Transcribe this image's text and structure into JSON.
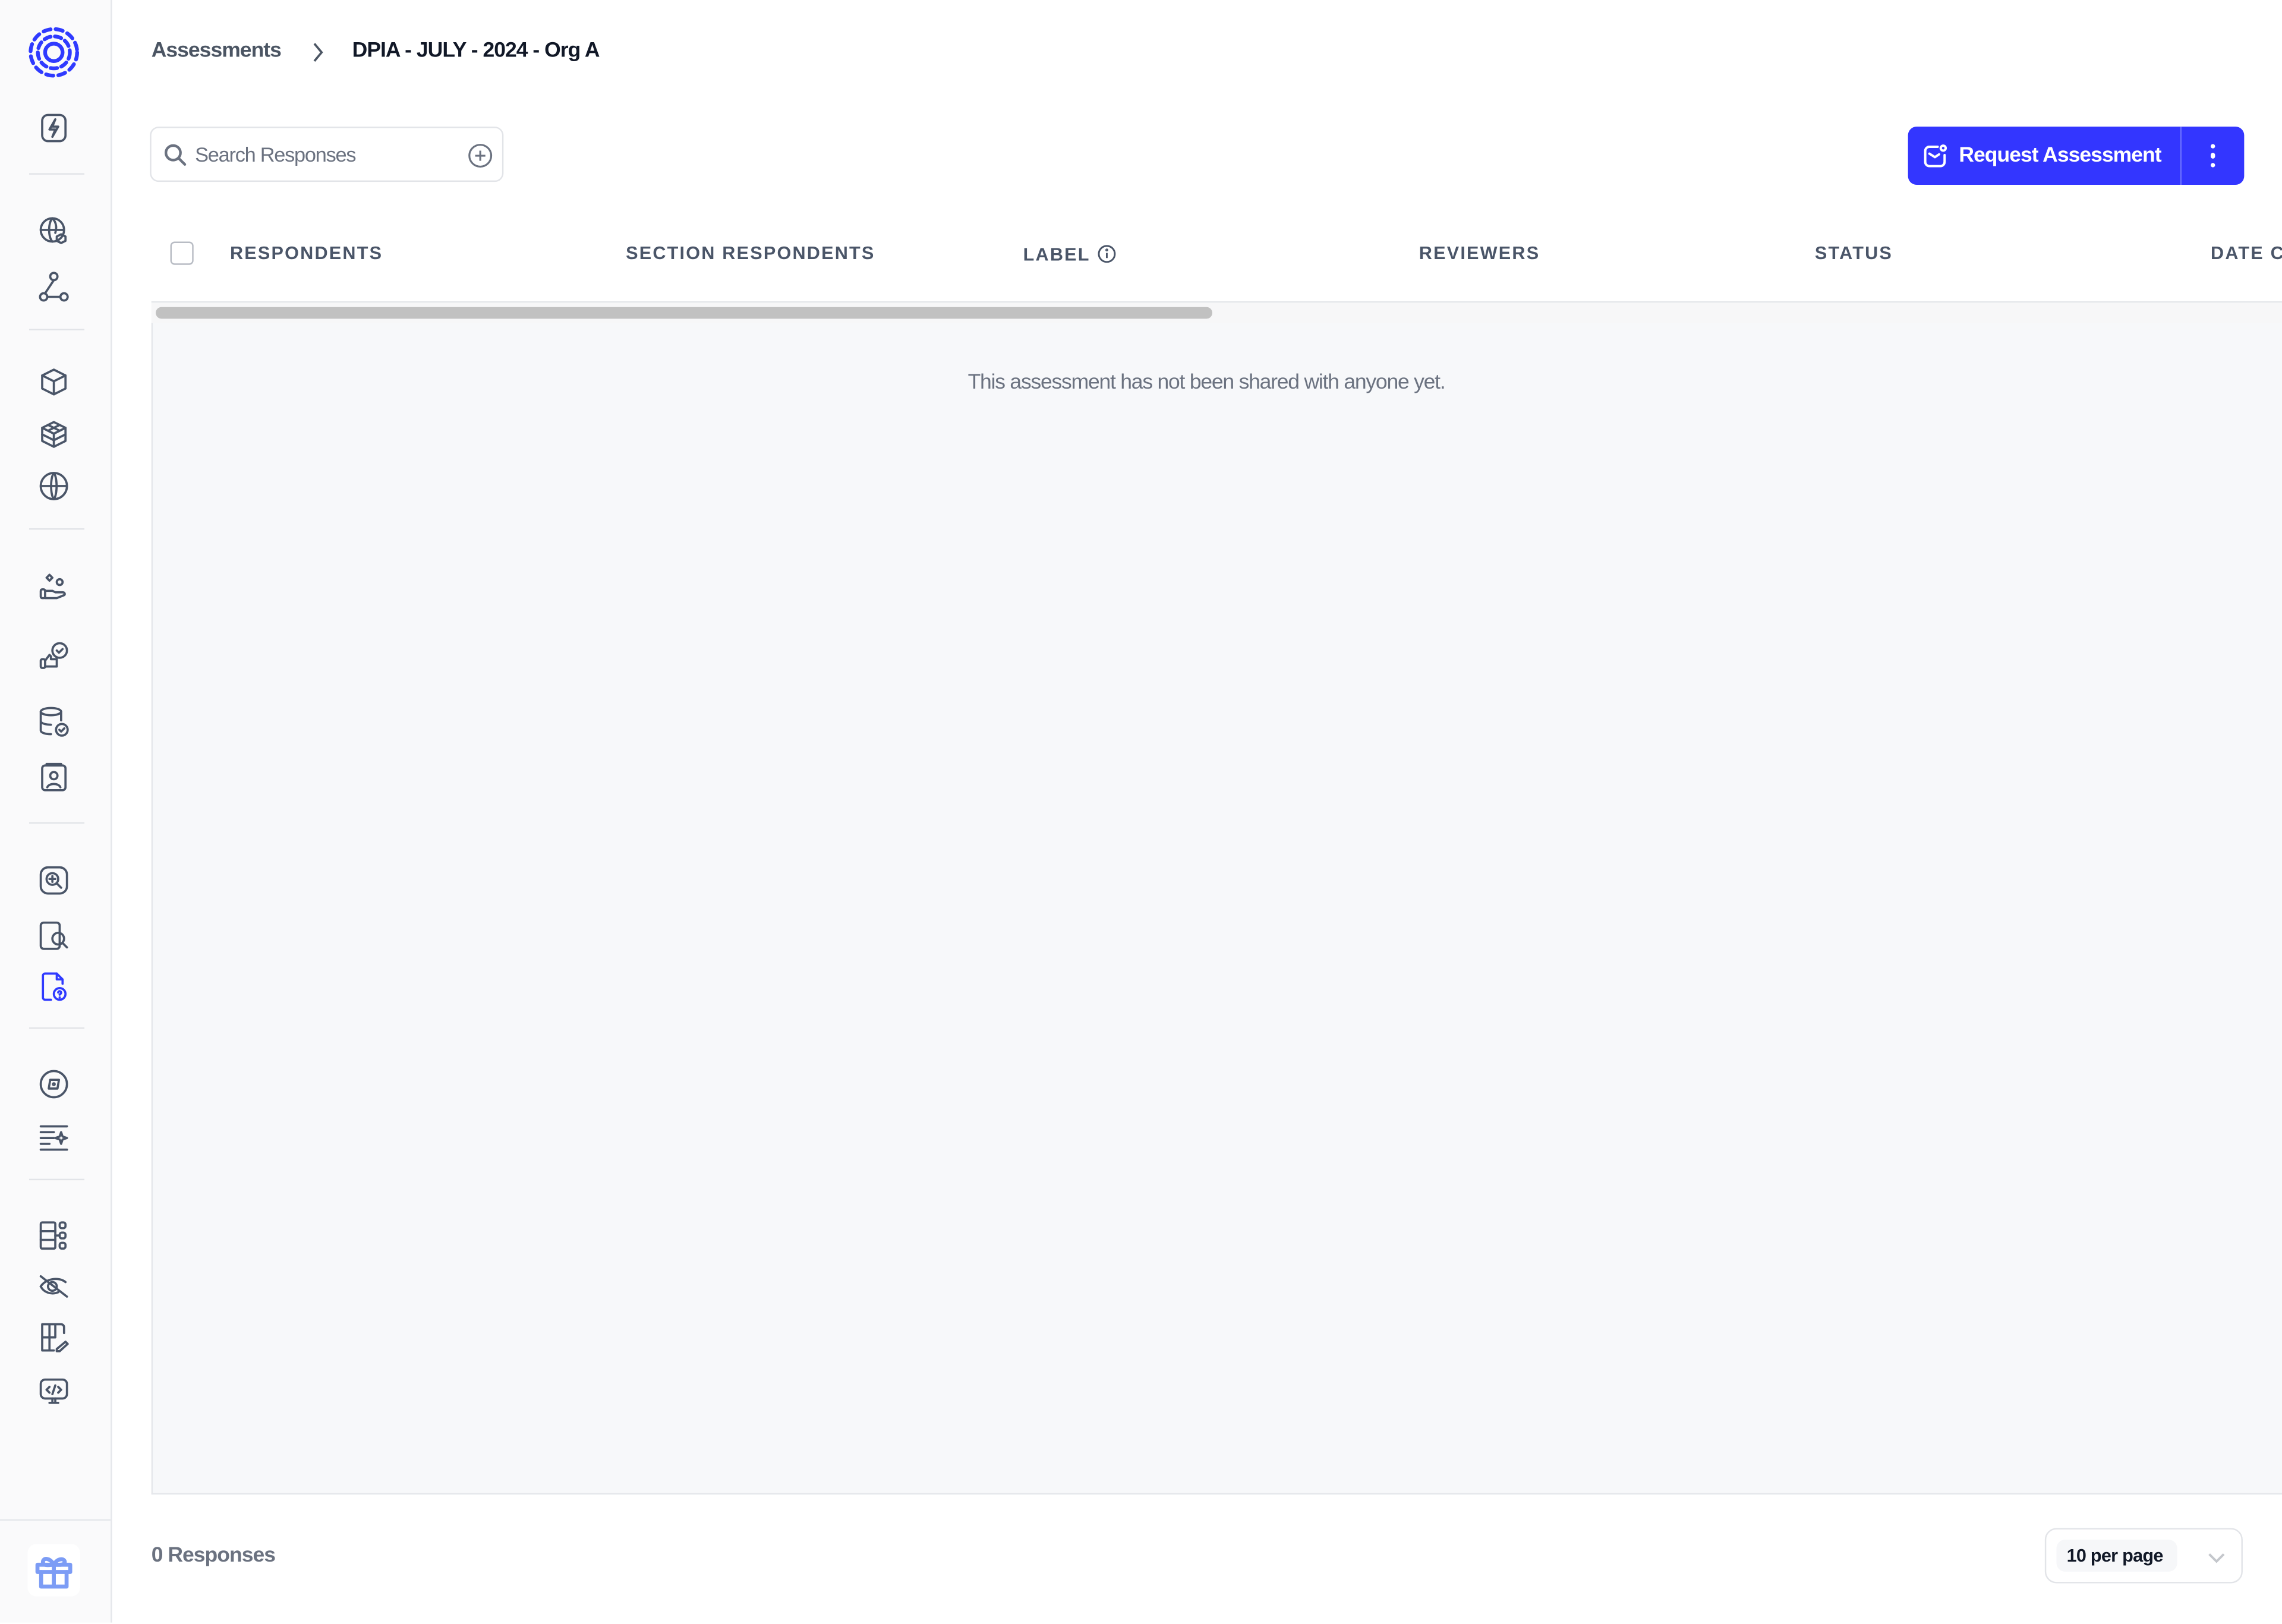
{
  "colors": {
    "accent": "#3336ff",
    "sidebar_bg": "#fafafb",
    "table_body_bg": "#f7f8fa",
    "icon_default": "#4a5568",
    "gift_icon": "#7c9cf5"
  },
  "sidebar": {
    "logo": "app-logo-dashed-rings",
    "items": [
      {
        "icon": "lightning-bolt-icon",
        "group": 1
      },
      {
        "icon": "globe-cube-icon",
        "group": 2
      },
      {
        "icon": "network-nodes-icon",
        "group": 2
      },
      {
        "icon": "box-icon",
        "group": 3
      },
      {
        "icon": "cubes-icon",
        "group": 3
      },
      {
        "icon": "globe-orbit-icon",
        "group": 3
      },
      {
        "icon": "hand-shapes-icon",
        "group": 4
      },
      {
        "icon": "thumbs-up-check-icon",
        "group": 4
      },
      {
        "icon": "database-check-icon",
        "group": 4
      },
      {
        "icon": "contact-card-icon",
        "group": 4
      },
      {
        "icon": "zoom-in-box-icon",
        "group": 5
      },
      {
        "icon": "document-search-icon",
        "group": 5
      },
      {
        "icon": "document-question-icon",
        "group": 5,
        "active": true
      },
      {
        "icon": "compass-icon",
        "group": 6
      },
      {
        "icon": "text-sparkle-icon",
        "group": 6
      },
      {
        "icon": "table-hierarchy-icon",
        "group": 7
      },
      {
        "icon": "eye-off-icon",
        "group": 7
      },
      {
        "icon": "grid-edit-icon",
        "group": 7
      },
      {
        "icon": "monitor-code-icon",
        "group": 7
      }
    ],
    "bottom_icon": "gift-icon"
  },
  "breadcrumb": {
    "parent": "Assessments",
    "current": "DPIA - JULY - 2024 - Org A"
  },
  "search": {
    "placeholder": "Search Responses",
    "value": ""
  },
  "actions": {
    "request_label": "Request Assessment",
    "more_icon": "kebab-menu-icon"
  },
  "table": {
    "columns": [
      "RESPONDENTS",
      "SECTION RESPONDENTS",
      "LABEL",
      "REVIEWERS",
      "STATUS",
      "DATE C"
    ],
    "rows": [],
    "empty_message": "This assessment has not been shared with anyone yet."
  },
  "footer": {
    "count_label": "0 Responses",
    "page_size_selected": "10 per page"
  }
}
